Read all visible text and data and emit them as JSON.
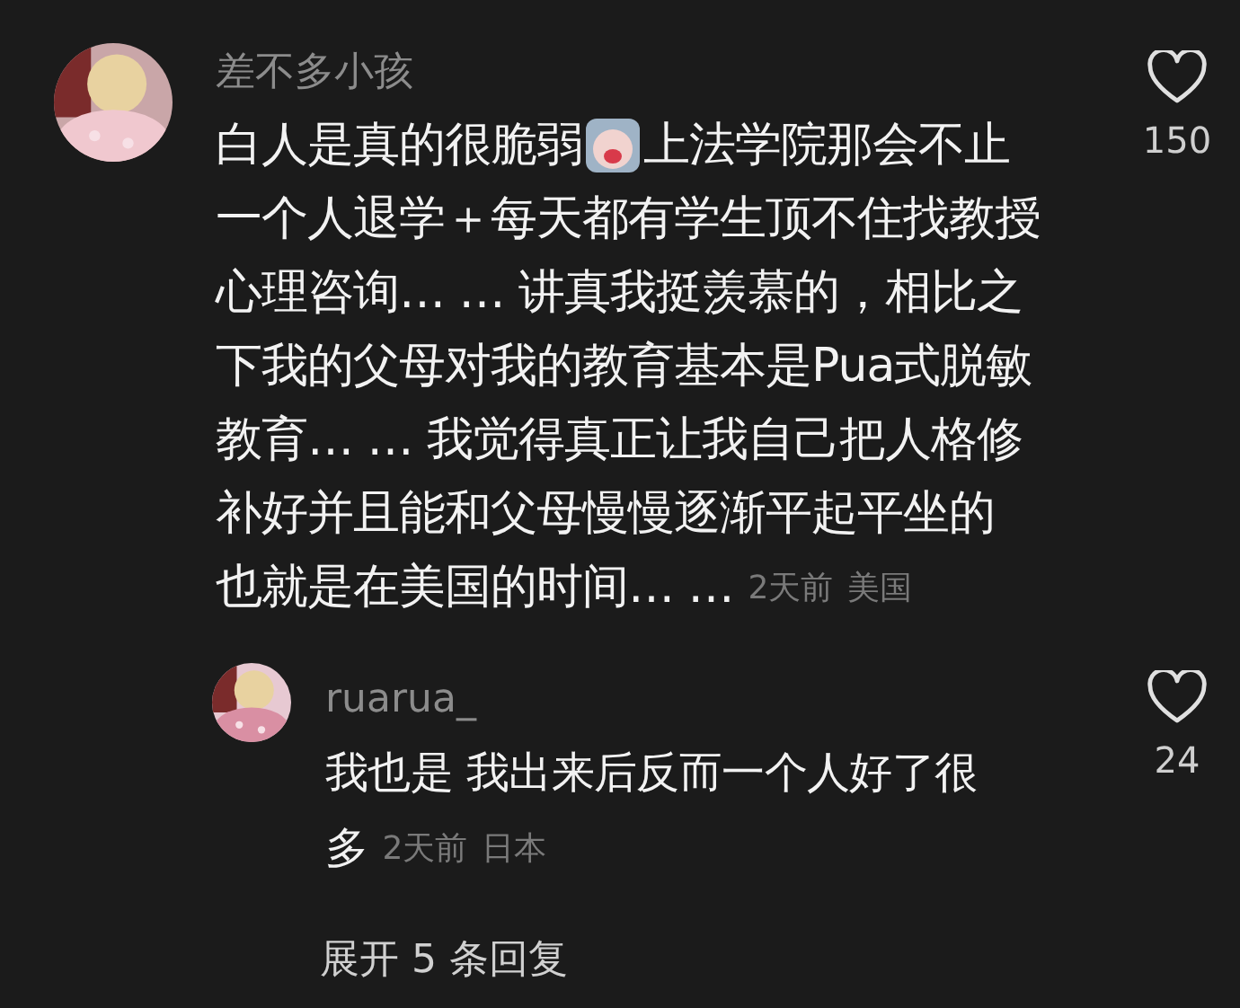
{
  "comments": [
    {
      "username": "差不多小孩",
      "lines": [
        [
          {
            "kind": "text",
            "text": "白人是真的很脆弱"
          },
          {
            "kind": "emoji"
          },
          {
            "kind": "text",
            "text": "上法学院那会不止"
          }
        ],
        [
          {
            "kind": "text",
            "text": "一个人退学＋每天都有学生顶不住找教授"
          }
        ],
        [
          {
            "kind": "text",
            "text": "心理咨询… … 讲真我挺羡慕的，相比之"
          }
        ],
        [
          {
            "kind": "text",
            "text": "下我的父母对我的教育基本是Pua式脱敏"
          }
        ],
        [
          {
            "kind": "text",
            "text": "教育… … 我觉得真正让我自己把人格修"
          }
        ],
        [
          {
            "kind": "text",
            "text": "补好并且能和父母慢慢逐渐平起平坐的"
          }
        ],
        [
          {
            "kind": "text",
            "text": "也就是在美国的时间… …"
          }
        ]
      ],
      "time": "2天前",
      "location": "美国",
      "likes": "150",
      "liked": false,
      "replies": [
        {
          "username": "ruarua_",
          "lines": [
            [
              {
                "kind": "text",
                "text": "我也是 我出来后反而一个人好了很"
              }
            ],
            [
              {
                "kind": "text",
                "text": "多"
              }
            ]
          ],
          "time": "2天前",
          "location": "日本",
          "likes": "24",
          "liked": false
        }
      ],
      "expand": "展开 5 条回复"
    }
  ]
}
